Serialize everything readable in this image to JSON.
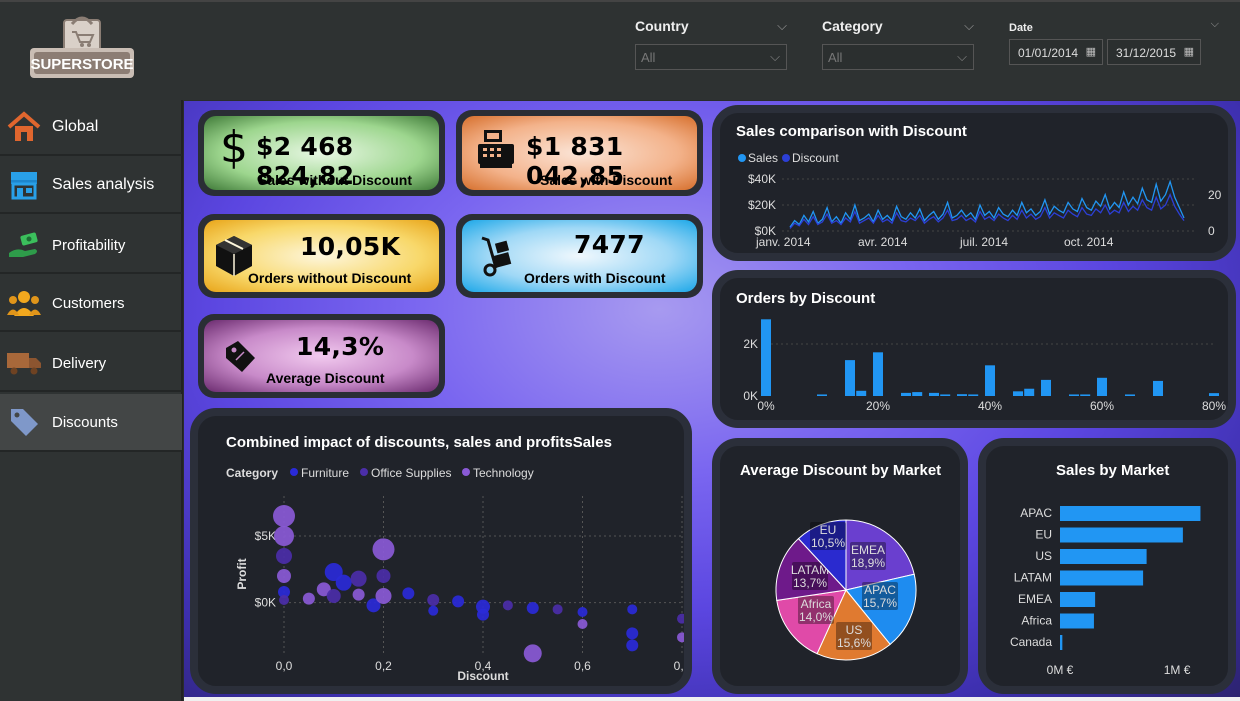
{
  "header": {
    "logo_text": "SUPERSTORE",
    "filters": [
      {
        "label": "Country",
        "value": "All"
      },
      {
        "label": "Category",
        "value": "All"
      }
    ],
    "date": {
      "label": "Date",
      "start": "01/01/2014",
      "end": "31/12/2015"
    }
  },
  "sidebar": {
    "items": [
      {
        "label": "Global",
        "icon": "home-icon",
        "active": false
      },
      {
        "label": "Sales analysis",
        "icon": "store-icon",
        "active": false
      },
      {
        "label": "Profitability",
        "icon": "hand-money-icon",
        "active": false
      },
      {
        "label": "Customers",
        "icon": "users-icon",
        "active": false
      },
      {
        "label": "Delivery",
        "icon": "truck-icon",
        "active": false
      },
      {
        "label": "Discounts",
        "icon": "tag-icon",
        "active": true
      }
    ]
  },
  "kpis": {
    "sales_no_discount": {
      "value": "$2 468 824,82",
      "label": "Sales without Discount",
      "symbol": "$"
    },
    "sales_discount": {
      "value": "$1 831 042,85",
      "label": "Sales with Discount"
    },
    "orders_no_discount": {
      "value": "10,05K",
      "label": "Orders without Discount"
    },
    "orders_discount": {
      "value": "7477",
      "label": "Orders with Discount"
    },
    "avg_discount": {
      "value": "14,3%",
      "label": "Average Discount"
    }
  },
  "colors": {
    "sales": "#2196f3",
    "discount": "#2c3fd6",
    "furniture": "#2a2ad8",
    "office_supplies": "#4b2ea8",
    "technology": "#8a5ad6",
    "bar": "#2196f3"
  },
  "chart_data": [
    {
      "type": "line",
      "title": "Sales comparison with Discount",
      "legend": [
        "Sales",
        "Discount"
      ],
      "x_ticks": [
        "janv. 2014",
        "avr. 2014",
        "juil. 2014",
        "oct. 2014"
      ],
      "y_ticks": [
        "$0K",
        "$20K",
        "$40K"
      ],
      "y2_ticks": [
        "0",
        "20"
      ],
      "ylim": [
        0,
        40000
      ],
      "series": [
        {
          "name": "Sales",
          "values": [
            3000,
            8000,
            5000,
            12000,
            7000,
            15000,
            6000,
            9000,
            18000,
            7000,
            11000,
            6000,
            14000,
            9000,
            20000,
            8000,
            10000,
            13000,
            7000,
            16000,
            9000,
            12000,
            8000,
            19000,
            11000,
            9000,
            14000,
            10000,
            17000,
            8000,
            12000,
            15000,
            9000,
            13000,
            22000,
            10000,
            12000,
            16000,
            11000,
            14000,
            9000,
            20000,
            12000,
            15000,
            10000,
            18000,
            13000,
            11000,
            16000,
            12000,
            22000,
            14000,
            17000,
            12000,
            15000,
            24000,
            13000,
            19000,
            16000,
            14000,
            22000,
            17000,
            15000,
            25000,
            18000,
            16000,
            23000,
            19000,
            28000,
            17000,
            22000,
            18000,
            30000,
            20000,
            26000,
            21000,
            33000,
            24000,
            22000,
            36000,
            23000,
            28000,
            38000,
            26000,
            18000,
            10000
          ]
        },
        {
          "name": "Discount",
          "values": [
            2000,
            6000,
            4000,
            9000,
            5000,
            11000,
            5000,
            7000,
            13000,
            6000,
            8000,
            5000,
            10000,
            7000,
            15000,
            6000,
            8000,
            10000,
            6000,
            12000,
            7000,
            9000,
            6000,
            14000,
            8000,
            7000,
            10000,
            8000,
            12000,
            6000,
            9000,
            11000,
            7000,
            10000,
            16000,
            8000,
            9000,
            12000,
            8000,
            10000,
            7000,
            15000,
            9000,
            11000,
            8000,
            13000,
            10000,
            8000,
            12000,
            9000,
            16000,
            10000,
            13000,
            9000,
            11000,
            18000,
            10000,
            14000,
            12000,
            10000,
            16000,
            13000,
            11000,
            18000,
            13000,
            12000,
            17000,
            14000,
            20000,
            13000,
            16000,
            14000,
            22000,
            15000,
            19000,
            16000,
            24000,
            18000,
            16000,
            26000,
            17000,
            20000,
            28000,
            19000,
            13000,
            8000
          ]
        }
      ]
    },
    {
      "type": "bar",
      "title": "Orders by Discount",
      "x_ticks": [
        "0%",
        "20%",
        "40%",
        "60%",
        "80%"
      ],
      "y_ticks": [
        "0K",
        "2K"
      ],
      "ylim": [
        0,
        3000
      ],
      "x": [
        0,
        0.1,
        0.15,
        0.17,
        0.2,
        0.25,
        0.27,
        0.3,
        0.32,
        0.35,
        0.37,
        0.4,
        0.45,
        0.47,
        0.5,
        0.55,
        0.57,
        0.6,
        0.65,
        0.7,
        0.8
      ],
      "values": [
        2950,
        60,
        1380,
        200,
        1680,
        120,
        150,
        120,
        60,
        70,
        60,
        1180,
        180,
        280,
        620,
        60,
        60,
        700,
        60,
        580,
        110
      ]
    },
    {
      "type": "scatter",
      "title": "Combined impact of discounts, sales and profitsSales",
      "xlabel": "Discount",
      "ylabel": "Profit",
      "legend_title": "Category",
      "legend": [
        "Furniture",
        "Office Supplies",
        "Technology"
      ],
      "x_ticks": [
        "0,0",
        "0,2",
        "0,4",
        "0,6",
        "0,8"
      ],
      "y_ticks": [
        "$0K",
        "$5K"
      ],
      "xlim": [
        0,
        0.8
      ],
      "ylim": [
        -4000,
        8000
      ],
      "points": [
        {
          "x": 0.0,
          "y": 6500,
          "s": 11,
          "c": "technology"
        },
        {
          "x": 0.0,
          "y": 5000,
          "s": 10,
          "c": "technology"
        },
        {
          "x": 0.0,
          "y": 3500,
          "s": 8,
          "c": "office_supplies"
        },
        {
          "x": 0.0,
          "y": 2000,
          "s": 7,
          "c": "technology"
        },
        {
          "x": 0.0,
          "y": 800,
          "s": 6,
          "c": "furniture"
        },
        {
          "x": 0.0,
          "y": 200,
          "s": 5,
          "c": "office_supplies"
        },
        {
          "x": 0.05,
          "y": 300,
          "s": 6,
          "c": "technology"
        },
        {
          "x": 0.08,
          "y": 1000,
          "s": 7,
          "c": "technology"
        },
        {
          "x": 0.1,
          "y": 2300,
          "s": 9,
          "c": "furniture"
        },
        {
          "x": 0.1,
          "y": 500,
          "s": 7,
          "c": "office_supplies"
        },
        {
          "x": 0.12,
          "y": 1500,
          "s": 8,
          "c": "furniture"
        },
        {
          "x": 0.15,
          "y": 1800,
          "s": 8,
          "c": "office_supplies"
        },
        {
          "x": 0.15,
          "y": 600,
          "s": 6,
          "c": "technology"
        },
        {
          "x": 0.18,
          "y": -200,
          "s": 7,
          "c": "furniture"
        },
        {
          "x": 0.2,
          "y": 4000,
          "s": 11,
          "c": "technology"
        },
        {
          "x": 0.2,
          "y": 2000,
          "s": 7,
          "c": "office_supplies"
        },
        {
          "x": 0.2,
          "y": 500,
          "s": 8,
          "c": "technology"
        },
        {
          "x": 0.25,
          "y": 700,
          "s": 6,
          "c": "furniture"
        },
        {
          "x": 0.3,
          "y": 200,
          "s": 6,
          "c": "office_supplies"
        },
        {
          "x": 0.3,
          "y": -600,
          "s": 5,
          "c": "furniture"
        },
        {
          "x": 0.35,
          "y": 100,
          "s": 6,
          "c": "furniture"
        },
        {
          "x": 0.4,
          "y": -300,
          "s": 7,
          "c": "furniture"
        },
        {
          "x": 0.4,
          "y": -900,
          "s": 6,
          "c": "furniture"
        },
        {
          "x": 0.45,
          "y": -200,
          "s": 5,
          "c": "office_supplies"
        },
        {
          "x": 0.5,
          "y": -400,
          "s": 6,
          "c": "furniture"
        },
        {
          "x": 0.5,
          "y": -3800,
          "s": 9,
          "c": "technology"
        },
        {
          "x": 0.55,
          "y": -500,
          "s": 5,
          "c": "office_supplies"
        },
        {
          "x": 0.6,
          "y": -700,
          "s": 5,
          "c": "furniture"
        },
        {
          "x": 0.6,
          "y": -1600,
          "s": 5,
          "c": "technology"
        },
        {
          "x": 0.7,
          "y": -500,
          "s": 5,
          "c": "furniture"
        },
        {
          "x": 0.7,
          "y": -2300,
          "s": 6,
          "c": "furniture"
        },
        {
          "x": 0.7,
          "y": -3200,
          "s": 6,
          "c": "furniture"
        },
        {
          "x": 0.8,
          "y": -1200,
          "s": 5,
          "c": "office_supplies"
        },
        {
          "x": 0.8,
          "y": -2600,
          "s": 5,
          "c": "technology"
        }
      ]
    },
    {
      "type": "pie",
      "title": "Average Discount by Market",
      "slices": [
        {
          "label": "EMEA",
          "value": 18.9,
          "display": "18,9%",
          "color": "#6a3fcf"
        },
        {
          "label": "APAC",
          "value": 15.7,
          "display": "15,7%",
          "color": "#1e8cf0"
        },
        {
          "label": "US",
          "value": 15.6,
          "display": "15,6%",
          "color": "#e07a30"
        },
        {
          "label": "Africa",
          "value": 14.0,
          "display": "14,0%",
          "color": "#e04aa8"
        },
        {
          "label": "LATAM",
          "value": 13.7,
          "display": "13,7%",
          "color": "#6e1a8a"
        },
        {
          "label": "EU",
          "value": 10.5,
          "display": "10,5%",
          "color": "#2a2acf"
        }
      ]
    },
    {
      "type": "bar",
      "orientation": "horizontal",
      "title": "Sales by Market",
      "categories": [
        "APAC",
        "EU",
        "US",
        "LATAM",
        "EMEA",
        "Africa",
        "Canada"
      ],
      "values": [
        1200000,
        1050000,
        740000,
        710000,
        300000,
        290000,
        20000
      ],
      "x_ticks": [
        "0M €",
        "1M €"
      ],
      "xlim": [
        0,
        1350000
      ]
    }
  ]
}
